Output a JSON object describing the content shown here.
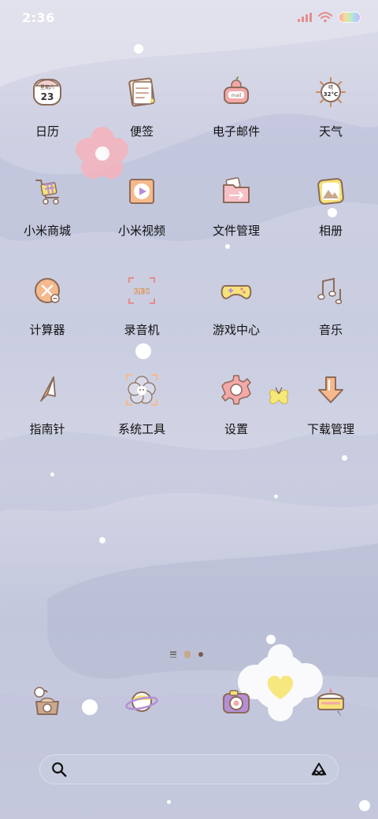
{
  "status_bar": {
    "time": "2:36"
  },
  "apps": [
    {
      "label": "日历",
      "icon": "calendar-icon",
      "calendar_day": "星期六",
      "calendar_date": "23"
    },
    {
      "label": "便签",
      "icon": "notes-icon"
    },
    {
      "label": "电子邮件",
      "icon": "mail-icon",
      "mail_text": "mail"
    },
    {
      "label": "天气",
      "icon": "weather-icon",
      "weather_temp": "32°C",
      "weather_cond": "晴"
    },
    {
      "label": "小米商城",
      "icon": "shopping-cart-icon"
    },
    {
      "label": "小米视频",
      "icon": "video-play-icon"
    },
    {
      "label": "文件管理",
      "icon": "folder-icon"
    },
    {
      "label": "相册",
      "icon": "gallery-icon"
    },
    {
      "label": "计算器",
      "icon": "calculator-icon"
    },
    {
      "label": "录音机",
      "icon": "recorder-icon",
      "rec_text": "REC"
    },
    {
      "label": "游戏中心",
      "icon": "gamepad-icon"
    },
    {
      "label": "音乐",
      "icon": "music-note-icon"
    },
    {
      "label": "指南针",
      "icon": "compass-icon"
    },
    {
      "label": "系统工具",
      "icon": "system-tools-folder-icon"
    },
    {
      "label": "设置",
      "icon": "gear-icon"
    },
    {
      "label": "下载管理",
      "icon": "download-icon"
    }
  ],
  "dock": [
    {
      "name": "phone",
      "icon": "telephone-icon"
    },
    {
      "name": "browser",
      "icon": "planet-icon"
    },
    {
      "name": "camera",
      "icon": "camera-icon"
    },
    {
      "name": "messages",
      "icon": "message-cake-icon"
    }
  ],
  "colors": {
    "accent_pink": "#f2b6b6",
    "accent_orange": "#f3b38a",
    "accent_yellow": "#f6e27a",
    "outline": "#8b6b5a"
  }
}
